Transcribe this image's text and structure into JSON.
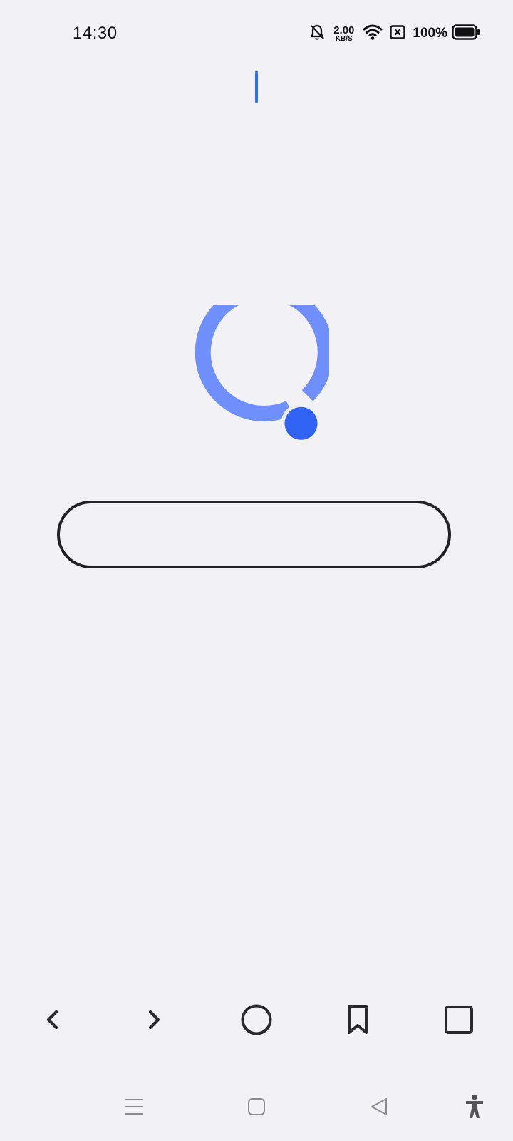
{
  "status_bar": {
    "time": "14:30",
    "net_speed_value": "2.00",
    "net_speed_unit": "KB/S",
    "battery_percent": "100%",
    "icons": [
      "bell-off-icon",
      "wifi-icon",
      "sim-x-icon",
      "battery-icon"
    ]
  },
  "search": {
    "value": "",
    "placeholder": ""
  },
  "logo": {
    "ring_color": "#6f8ffc",
    "dot_color": "#3164f4"
  },
  "toolbar": {
    "buttons": [
      "back-icon",
      "forward-icon",
      "home-icon",
      "bookmark-icon",
      "tabs-icon"
    ]
  },
  "system_nav": {
    "buttons": [
      "menu-icon",
      "home-square-icon",
      "back-triangle-icon",
      "accessibility-icon"
    ]
  },
  "colors": {
    "background": "#f1f1f6",
    "cursor": "#2f6fe0",
    "field_border": "#222226"
  }
}
